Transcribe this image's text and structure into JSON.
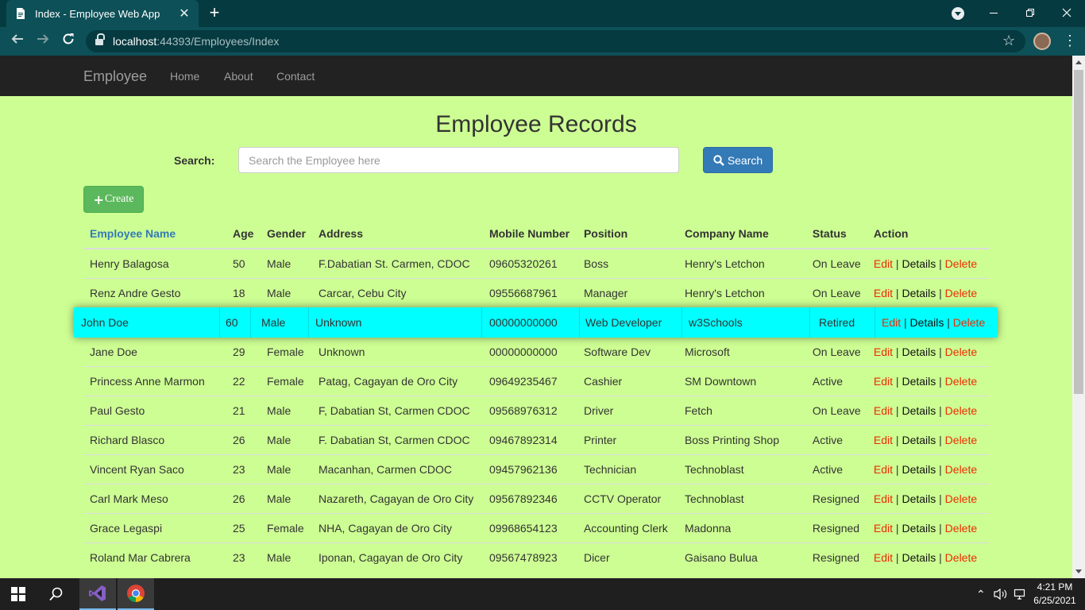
{
  "browser": {
    "tab_title": "Index - Employee Web App",
    "url_host": "localhost",
    "url_rest": ":44393/Employees/Index"
  },
  "nav": {
    "brand": "Employee",
    "links": [
      "Home",
      "About",
      "Contact"
    ]
  },
  "page": {
    "title": "Employee Records",
    "search_label": "Search:",
    "search_placeholder": "Search the Employee here",
    "search_button": "Search",
    "create_button": "Create"
  },
  "table": {
    "headers": [
      "Employee Name",
      "Age",
      "Gender",
      "Address",
      "Mobile Number",
      "Position",
      "Company Name",
      "Status",
      "Action"
    ],
    "action_labels": {
      "edit": "Edit",
      "details": "Details",
      "delete": "Delete",
      "sep": "|"
    },
    "rows": [
      {
        "name": "Henry Balagosa",
        "age": "50",
        "gender": "Male",
        "address": "F.Dabatian St. Carmen, CDOC",
        "mobile": "09605320261",
        "position": "Boss",
        "company": "Henry's Letchon",
        "status": "On Leave"
      },
      {
        "name": "Renz Andre Gesto",
        "age": "18",
        "gender": "Male",
        "address": "Carcar, Cebu City",
        "mobile": "09556687961",
        "position": "Manager",
        "company": "Henry's Letchon",
        "status": "On Leave"
      },
      {
        "name": "John Doe",
        "age": "60",
        "gender": "Male",
        "address": "Unknown",
        "mobile": "00000000000",
        "position": "Web Developer",
        "company": "w3Schools",
        "status": "Retired"
      },
      {
        "name": "Jane Doe",
        "age": "29",
        "gender": "Female",
        "address": "Unknown",
        "mobile": "00000000000",
        "position": "Software Dev",
        "company": "Microsoft",
        "status": "On Leave"
      },
      {
        "name": "Princess Anne Marmon",
        "age": "22",
        "gender": "Female",
        "address": "Patag, Cagayan de Oro City",
        "mobile": "09649235467",
        "position": "Cashier",
        "company": "SM Downtown",
        "status": "Active"
      },
      {
        "name": "Paul Gesto",
        "age": "21",
        "gender": "Male",
        "address": "F, Dabatian St, Carmen CDOC",
        "mobile": "09568976312",
        "position": "Driver",
        "company": "Fetch",
        "status": "On Leave"
      },
      {
        "name": "Richard Blasco",
        "age": "26",
        "gender": "Male",
        "address": "F. Dabatian St, Carmen CDOC",
        "mobile": "09467892314",
        "position": "Printer",
        "company": "Boss Printing Shop",
        "status": "Active"
      },
      {
        "name": "Vincent Ryan Saco",
        "age": "23",
        "gender": "Male",
        "address": "Macanhan, Carmen CDOC",
        "mobile": "09457962136",
        "position": "Technician",
        "company": "Technoblast",
        "status": "Active"
      },
      {
        "name": "Carl Mark Meso",
        "age": "26",
        "gender": "Male",
        "address": "Nazareth, Cagayan de Oro City",
        "mobile": "09567892346",
        "position": "CCTV Operator",
        "company": "Technoblast",
        "status": "Resigned"
      },
      {
        "name": "Grace Legaspi",
        "age": "25",
        "gender": "Female",
        "address": "NHA, Cagayan de Oro City",
        "mobile": "09968654123",
        "position": "Accounting Clerk",
        "company": "Madonna",
        "status": "Resigned"
      },
      {
        "name": "Roland Mar Cabrera",
        "age": "23",
        "gender": "Male",
        "address": "Iponan, Cagayan de Oro City",
        "mobile": "09567478923",
        "position": "Dicer",
        "company": "Gaisano Bulua",
        "status": "Resigned"
      }
    ]
  },
  "taskbar": {
    "time": "4:21 PM",
    "date": "6/25/2021"
  },
  "colors": {
    "page_bg": "#cdfe93",
    "highlight": "#00ffff",
    "link_red": "#ee2c00",
    "primary": "#337ab7",
    "success": "#5cb85c"
  }
}
